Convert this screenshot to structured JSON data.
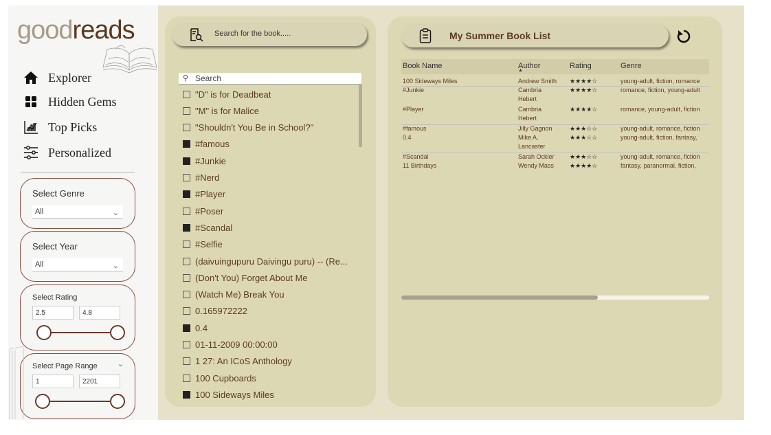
{
  "logo": {
    "light": "good",
    "bold": "reads"
  },
  "nav": [
    {
      "label": "Explorer",
      "icon": "home-icon"
    },
    {
      "label": "Hidden Gems",
      "icon": "grid-icon"
    },
    {
      "label": "Top Picks",
      "icon": "chart-icon"
    },
    {
      "label": "Personalized",
      "icon": "sliders-icon"
    }
  ],
  "filters": {
    "genre": {
      "title": "Select Genre",
      "value": "All"
    },
    "year": {
      "title": "Select Year",
      "value": "All"
    },
    "rating": {
      "title": "Select Rating",
      "min": "2.5",
      "max": "4.8"
    },
    "pages": {
      "title": "Select Page Range",
      "min": "1",
      "max": "2201"
    }
  },
  "book_search": {
    "placeholder": "Search for the book.....",
    "list_search": "Search"
  },
  "book_list": [
    {
      "label": "\"D\" is for Deadbeat",
      "checked": false
    },
    {
      "label": "\"M\" is for Malice",
      "checked": false
    },
    {
      "label": "\"Shouldn't You Be in School?\"",
      "checked": false
    },
    {
      "label": "#famous",
      "checked": true
    },
    {
      "label": "#Junkie",
      "checked": true
    },
    {
      "label": "#Nerd",
      "checked": false
    },
    {
      "label": "#Player",
      "checked": true
    },
    {
      "label": "#Poser",
      "checked": false
    },
    {
      "label": "#Scandal",
      "checked": true
    },
    {
      "label": "#Selfie",
      "checked": false
    },
    {
      "label": "(daivuingupuru Daivingu puru) -- (Re...",
      "checked": false
    },
    {
      "label": "(Don't You) Forget About Me",
      "checked": false
    },
    {
      "label": "(Watch Me) Break You",
      "checked": false
    },
    {
      "label": "0.165972222",
      "checked": false
    },
    {
      "label": "0.4",
      "checked": true
    },
    {
      "label": "01-11-2009 00:00:00",
      "checked": false
    },
    {
      "label": "1 27: An ICoS Anthology",
      "checked": false
    },
    {
      "label": "100 Cupboards",
      "checked": false
    },
    {
      "label": "100 Sideways Miles",
      "checked": true
    }
  ],
  "summer_list": {
    "title": "My Summer Book List",
    "columns": [
      "Book Name",
      "Author",
      "Rating",
      "Genre"
    ],
    "rows": [
      {
        "book": "100 Sideways Miles",
        "author": "Andrew Smith",
        "author2": "",
        "rating": "★★★★☆",
        "genre": "young-adult, fiction, romance"
      },
      {
        "book": "#Junkie",
        "author": "Cambria",
        "author2": "Hebert",
        "rating": "★★★★☆",
        "genre": "romance, fiction, young-adult"
      },
      {
        "book": "#Player",
        "author": "Cambria",
        "author2": "Hebert",
        "rating": "★★★★☆",
        "genre": "romance, young-adult, fiction"
      },
      {
        "book": "#famous",
        "author": "Jilly Gagnon",
        "author2": "",
        "rating": "★★★☆☆",
        "genre": "young-adult, romance, fiction"
      },
      {
        "book": "0.4",
        "author": "Mike A.",
        "author2": "Lancaster",
        "rating": "★★★☆☆",
        "genre": "young-adult, fiction, fantasy,"
      },
      {
        "book": "#Scandal",
        "author": "Sarah Ockler",
        "author2": "",
        "rating": "★★★☆☆",
        "genre": "young-adult, romance, fiction"
      },
      {
        "book": "11 Birthdays",
        "author": "Wendy Mass",
        "author2": "",
        "rating": "★★★★☆",
        "genre": "fantasy, paranormal, fiction,"
      }
    ]
  },
  "colors": {
    "brand_brown": "#5a3a22",
    "panel": "#ddd8b4",
    "background": "#e6e1c8",
    "accent_red": "#8b4a3a"
  }
}
